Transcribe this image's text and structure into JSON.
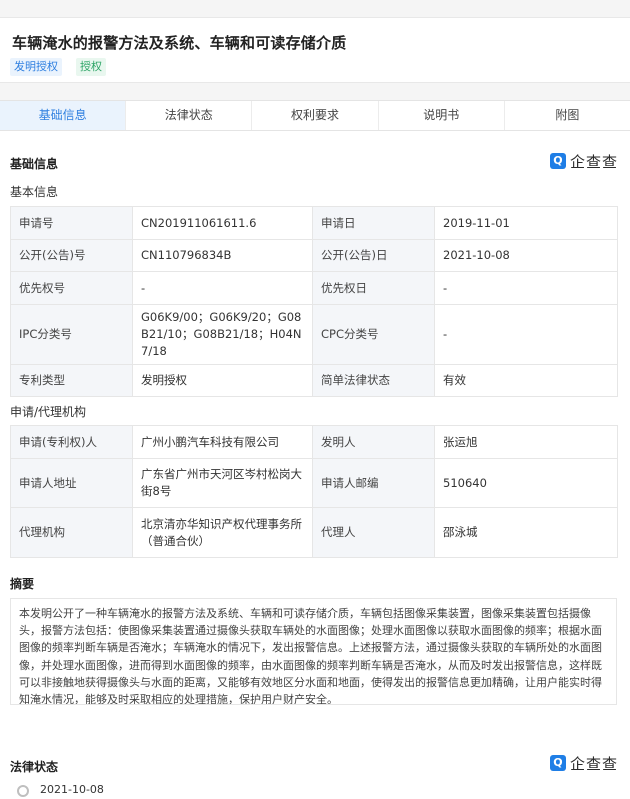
{
  "patent": {
    "title": "车辆淹水的报警方法及系统、车辆和可读存储介质",
    "tags": {
      "type": "发明授权",
      "status": "授权"
    }
  },
  "tabs": [
    "基础信息",
    "法律状态",
    "权利要求",
    "说明书",
    "附图"
  ],
  "brand": {
    "mark": "Q",
    "name": "企查查"
  },
  "basic": {
    "section_title": "基础信息",
    "subsection_title": "基本信息",
    "rows": [
      [
        "申请号",
        "CN201911061611.6",
        "申请日",
        "2019-11-01"
      ],
      [
        "公开(公告)号",
        "CN110796834B",
        "公开(公告)日",
        "2021-10-08"
      ],
      [
        "优先权号",
        "-",
        "优先权日",
        "-"
      ],
      [
        "IPC分类号",
        "G06K9/00；G06K9/20；G08B21/10；G08B21/18；H04N7/18",
        "CPC分类号",
        "-"
      ],
      [
        "专利类型",
        "发明授权",
        "简单法律状态",
        "有效"
      ]
    ]
  },
  "applicant": {
    "subsection_title": "申请/代理机构",
    "rows": [
      [
        "申请(专利权)人",
        "广州小鹏汽车科技有限公司",
        "发明人",
        "张运旭"
      ],
      [
        "申请人地址",
        "广东省广州市天河区岑村松岗大街8号",
        "申请人邮编",
        "510640"
      ],
      [
        "代理机构",
        "北京清亦华知识产权代理事务所（普通合伙）",
        "代理人",
        "邵泳城"
      ]
    ]
  },
  "abstract": {
    "title": "摘要",
    "text": "本发明公开了一种车辆淹水的报警方法及系统、车辆和可读存储介质，车辆包括图像采集装置，图像采集装置包括摄像头，报警方法包括：使图像采集装置通过摄像头获取车辆处的水面图像；处理水面图像以获取水面图像的频率；根据水面图像的频率判断车辆是否淹水；车辆淹水的情况下，发出报警信息。上述报警方法，通过摄像头获取的车辆所处的水面图像，并处理水面图像，进而得到水面图像的频率，由水面图像的频率判断车辆是否淹水，从而及时发出报警信息，这样既可以非接触地获得摄像头与水面的距离，又能够有效地区分水面和地面，使得发出的报警信息更加精确，让用户能实时得知淹水情况，能够及时采取相应的处理措施，保护用户财产安全。"
  },
  "legal": {
    "title": "法律状态",
    "first_date": "2021-10-08"
  },
  "colors": {
    "accent": "#2e7fe0",
    "valid": "#2ea567",
    "label_bg": "#f4f6f9"
  }
}
